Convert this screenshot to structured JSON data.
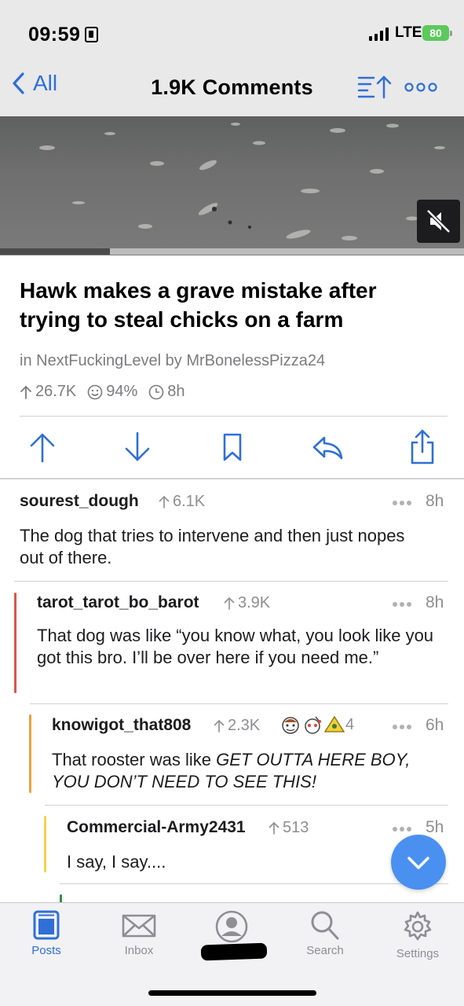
{
  "status_bar": {
    "time": "09:59",
    "network": "LTE",
    "battery": "80"
  },
  "nav": {
    "back_label": "All",
    "title": "1.9K Comments"
  },
  "video": {
    "progress": 0.237,
    "muted": true
  },
  "post": {
    "title": "Hawk makes a grave mistake after trying to steal chicks on a farm",
    "in_label": "in",
    "subreddit": "NextFuckingLevel",
    "by_label": "by",
    "author": "MrBonelessPizza24",
    "score": "26.7K",
    "upvote_ratio": "94%",
    "age": "8h"
  },
  "actions": [
    "upvote",
    "downvote",
    "save",
    "reply",
    "share"
  ],
  "comments": [
    {
      "user": "sourest_dough",
      "score": "6.1K",
      "time": "8h",
      "body": "The dog that tries to intervene and then just nopes out of there.",
      "depth": 0
    },
    {
      "user": "tarot_tarot_bo_barot",
      "score": "3.9K",
      "time": "8h",
      "body": "That dog was like “you know what, you look like you got this bro. I’ll be over here if you need me.”",
      "depth": 1,
      "bar_color": "#d9554a"
    },
    {
      "user": "knowigot_that808",
      "score": "2.3K",
      "time": "6h",
      "body": "GET OUTTA HERE BOY, YOU DON’T NEED TO SEE THIS!",
      "body_prefix": "That rooster was like ",
      "depth": 2,
      "bar_color": "#f0a03c",
      "awards_count": "4"
    },
    {
      "user": "Commercial-Army2431",
      "score": "513",
      "time": "5h",
      "body": "I say, I say....",
      "depth": 3,
      "bar_color": "#f3d34a"
    }
  ],
  "tabs": [
    {
      "label": "Posts",
      "icon": "posts-icon",
      "active": true
    },
    {
      "label": "Inbox",
      "icon": "mail-icon",
      "active": false
    },
    {
      "label": "",
      "icon": "profile-icon",
      "active": false
    },
    {
      "label": "Search",
      "icon": "search-icon",
      "active": false
    },
    {
      "label": "Settings",
      "icon": "gear-icon",
      "active": false
    }
  ],
  "colors": {
    "accent": "#2f6fd6",
    "fab": "#4a90f0",
    "meta_gray": "#8e8e93"
  }
}
